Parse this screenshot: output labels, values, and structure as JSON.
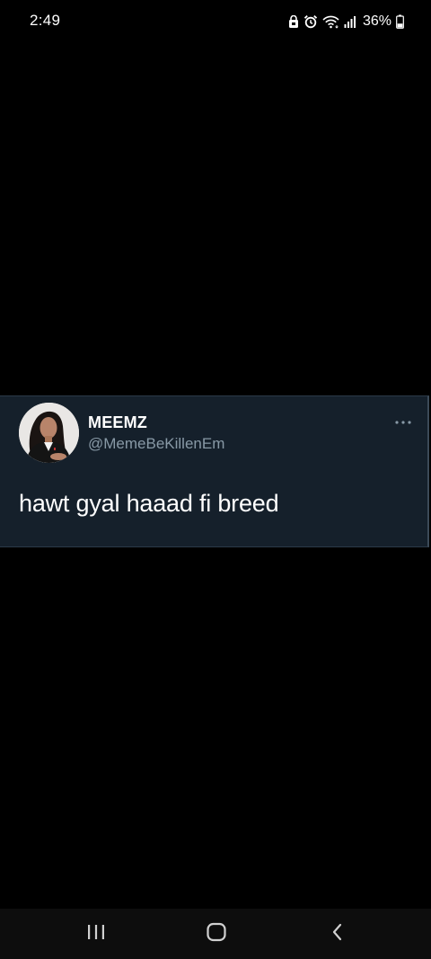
{
  "status_bar": {
    "time": "2:49",
    "battery_percent": "36%",
    "battery_level": 0.36,
    "icons": [
      "lock-icon",
      "alarm-icon",
      "wifi-icon",
      "signal-icon",
      "battery-icon"
    ]
  },
  "tweet": {
    "author_name": "MEEMZ",
    "author_handle": "@MemeBeKillenEm",
    "text": "hawt gyal haaad fi breed",
    "more_icon": "more-horizontal-icon"
  },
  "nav_bar": {
    "buttons": [
      "recent-apps-icon",
      "home-icon",
      "back-icon"
    ]
  },
  "colors": {
    "background": "#000000",
    "card_background": "#15202b",
    "handle_text": "#8899a6",
    "primary_text": "#ffffff"
  }
}
